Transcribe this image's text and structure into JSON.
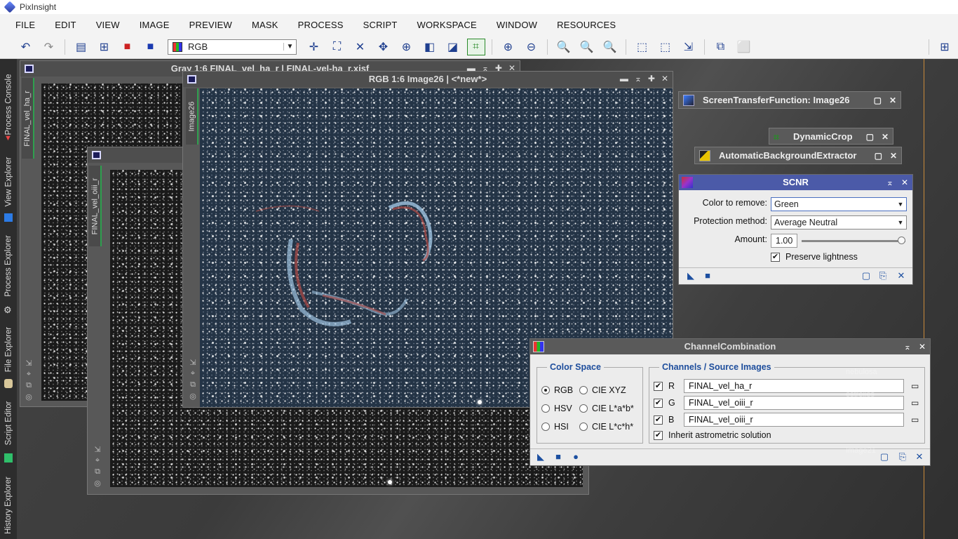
{
  "app": {
    "title": "PixInsight"
  },
  "menu": [
    "FILE",
    "EDIT",
    "VIEW",
    "IMAGE",
    "PREVIEW",
    "MASK",
    "PROCESS",
    "SCRIPT",
    "WORKSPACE",
    "WINDOW",
    "RESOURCES"
  ],
  "toolbar": {
    "color_mode": "RGB"
  },
  "side_tabs": [
    "Process Console",
    "View Explorer",
    "Process Explorer",
    "File Explorer",
    "Script Editor",
    "History Explorer"
  ],
  "windows": {
    "gray1": {
      "title": "Gray 1:6 FINAL_vel_ha_r | FINAL-vel-ha_r.xisf",
      "view_id": "FINAL_vel_ha_r"
    },
    "gray2": {
      "view_id": "FINAL_vel_oiii_r"
    },
    "rgb": {
      "title": "RGB 1:6 Image26 | <*new*>",
      "view_id": "Image26"
    }
  },
  "tools": {
    "stf": "ScreenTransferFunction: Image26",
    "dynamic_crop": "DynamicCrop",
    "abe": "AutomaticBackgroundExtractor"
  },
  "scnr": {
    "title": "SCNR",
    "color_label": "Color to remove:",
    "color_value": "Green",
    "protection_label": "Protection method:",
    "protection_value": "Average Neutral",
    "amount_label": "Amount:",
    "amount_value": "1.00",
    "amount_fraction": 1.0,
    "preserve_label": "Preserve lightness",
    "preserve_checked": true
  },
  "channel_combination": {
    "title": "ChannelCombination",
    "color_space_title": "Color Space",
    "color_spaces": [
      "RGB",
      "CIE XYZ",
      "HSV",
      "CIE L*a*b*",
      "HSI",
      "CIE L*c*h*"
    ],
    "selected_space": "RGB",
    "channels_title": "Channels / Source Images",
    "channels": [
      {
        "letter": "R",
        "image": "FINAL_vel_ha_r",
        "checked": true
      },
      {
        "letter": "G",
        "image": "FINAL_vel_oiii_r",
        "checked": true
      },
      {
        "letter": "B",
        "image": "FINAL_vel_oiii_r",
        "checked": true
      }
    ],
    "inherit_label": "Inherit astrometric solution",
    "inherit_checked": true
  },
  "ghost_icons": [
    "nebulosa",
    "estrelles",
    "estreles2",
    "Image21"
  ]
}
